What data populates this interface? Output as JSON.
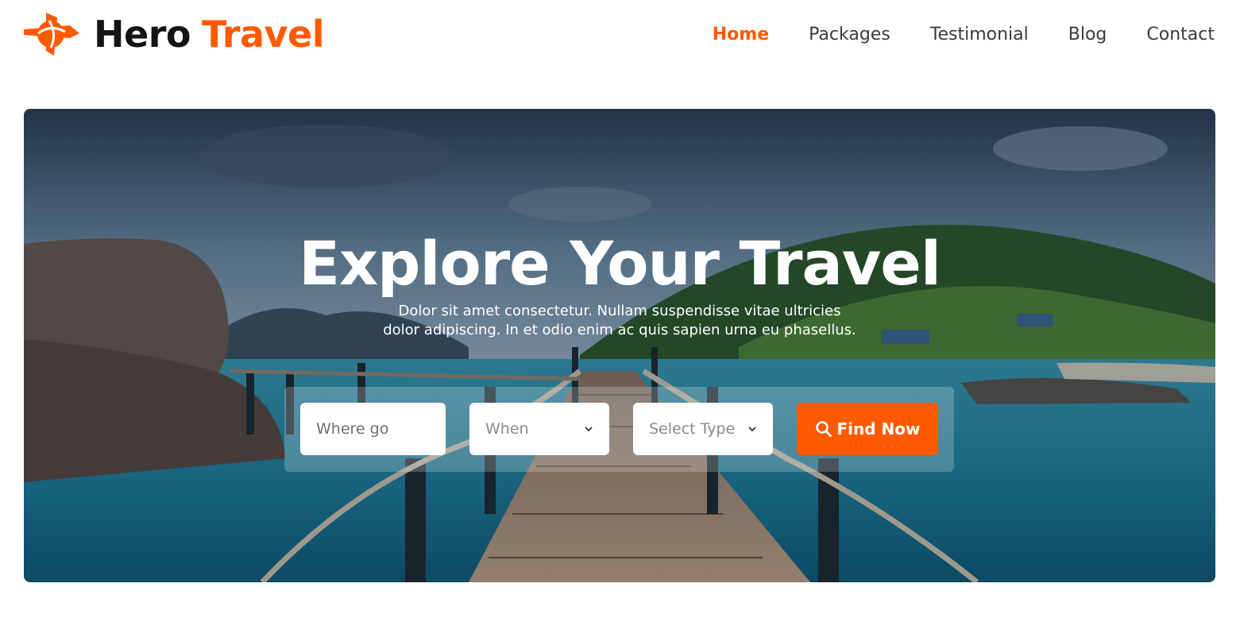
{
  "brand": {
    "name_part1": "Hero",
    "name_part2": "Travel",
    "logo_icon": "compass-plane-icon",
    "accent_color": "#ff5a00",
    "dark_color": "#141414"
  },
  "nav": {
    "items": [
      {
        "label": "Home",
        "active": true
      },
      {
        "label": "Packages",
        "active": false
      },
      {
        "label": "Testimonial",
        "active": false
      },
      {
        "label": "Blog",
        "active": false
      },
      {
        "label": "Contact",
        "active": false
      }
    ]
  },
  "hero": {
    "title": "Explore Your Travel",
    "subtitle_line1": "Dolor sit amet consectetur. Nullam suspendisse vitae ultricies",
    "subtitle_line2": "dolor adipiscing. In et odio enim ac quis sapien urna eu phasellus.",
    "background": "tropical-pier-photo"
  },
  "search": {
    "where_placeholder": "Where go",
    "when_selected": "When",
    "type_selected": "Select Type",
    "find_button_label": "Find Now",
    "find_button_icon": "search-icon"
  }
}
